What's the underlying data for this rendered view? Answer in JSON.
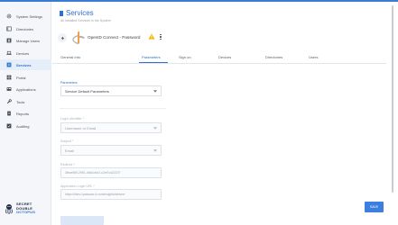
{
  "sidebar": {
    "items": [
      {
        "label": "System Settings",
        "icon": "gear-icon",
        "active": false
      },
      {
        "label": "Directories",
        "icon": "folder-icon",
        "active": false
      },
      {
        "label": "Manage Users",
        "icon": "user-card-icon",
        "active": false
      },
      {
        "label": "Devices",
        "icon": "laptop-icon",
        "active": false
      },
      {
        "label": "Services",
        "icon": "services-icon",
        "active": true
      },
      {
        "label": "Portal",
        "icon": "grid-icon",
        "active": false
      },
      {
        "label": "Applications",
        "icon": "apps-icon",
        "active": false
      },
      {
        "label": "Tools",
        "icon": "wrench-icon",
        "active": false
      },
      {
        "label": "Reports",
        "icon": "report-icon",
        "active": false
      },
      {
        "label": "Auditing",
        "icon": "audit-icon",
        "active": false
      }
    ],
    "logo": {
      "line1": "SECRET",
      "line2": "DOUBLE",
      "line3": "OCTOPUS"
    }
  },
  "header": {
    "title": "Services",
    "subtitle": "All installed Services in the System",
    "service_name": "OpenID Connect - Password"
  },
  "tabs": [
    {
      "label": "General Info",
      "active": false
    },
    {
      "label": "Parameters",
      "active": true
    },
    {
      "label": "Sign on",
      "active": false
    },
    {
      "label": "Devices",
      "active": false
    },
    {
      "label": "Directories",
      "active": false
    },
    {
      "label": "Users",
      "active": false
    }
  ],
  "form": {
    "parameters": {
      "label": "Parameters",
      "value": "Service Default Parameters"
    },
    "login_identifier": {
      "label": "Login Identifier *",
      "value": "Username or Email"
    },
    "subject": {
      "label": "Subject *",
      "value": "Email"
    },
    "redirect": {
      "label": "Redirect *",
      "value": "3fece959-2991-4fdd-b0e2-c2ef7cd22197"
    },
    "app_login_url": {
      "label": "Application Login URL *",
      "value": "https://idsrv.1passwor.d.com/insights/before/"
    }
  },
  "actions": {
    "save_label": "SAVE"
  },
  "colors": {
    "accent": "#2f6fd0",
    "warning": "#f5b400",
    "save": "#3c7fe0"
  }
}
